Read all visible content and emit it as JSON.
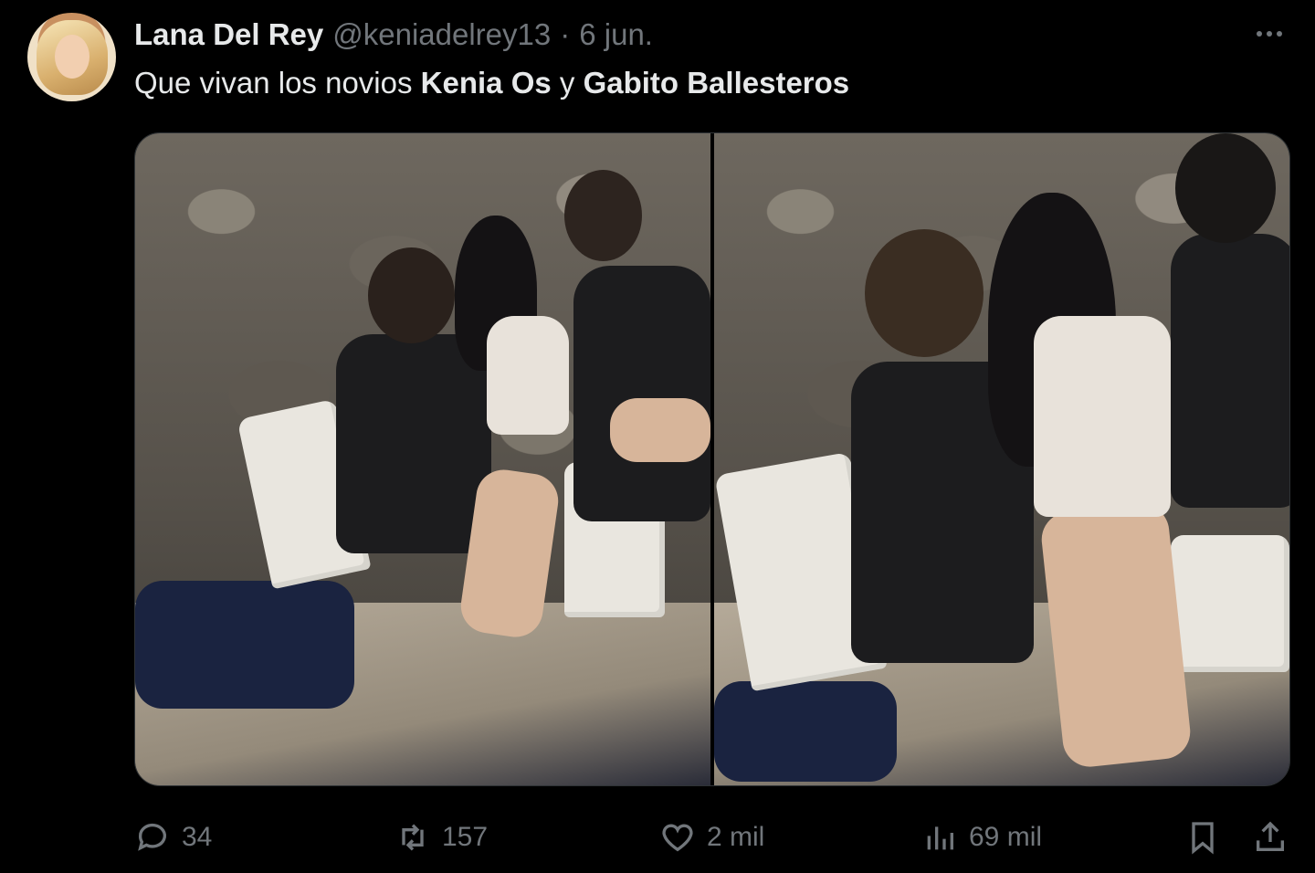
{
  "author": {
    "display_name": "Lana Del Rey",
    "handle": "@keniadelrey13",
    "separator": "·",
    "date": "6 jun."
  },
  "tweet": {
    "text_plain": "Que vivan los novios ",
    "name_1": "Kenia Os",
    "connector": " y ",
    "name_2": "Gabito Ballesteros"
  },
  "stats": {
    "replies": "34",
    "reposts": "157",
    "likes": "2 mil",
    "views": "69 mil"
  },
  "icons": {
    "more": "more-horizontal-icon",
    "reply": "reply-bubble-icon",
    "repost": "repost-arrows-icon",
    "like": "heart-icon",
    "views": "views-chart-icon",
    "bookmark": "bookmark-icon",
    "share": "share-upload-icon"
  },
  "colors": {
    "background": "#000000",
    "text_primary": "#e7e9ea",
    "text_secondary": "#71767b"
  }
}
